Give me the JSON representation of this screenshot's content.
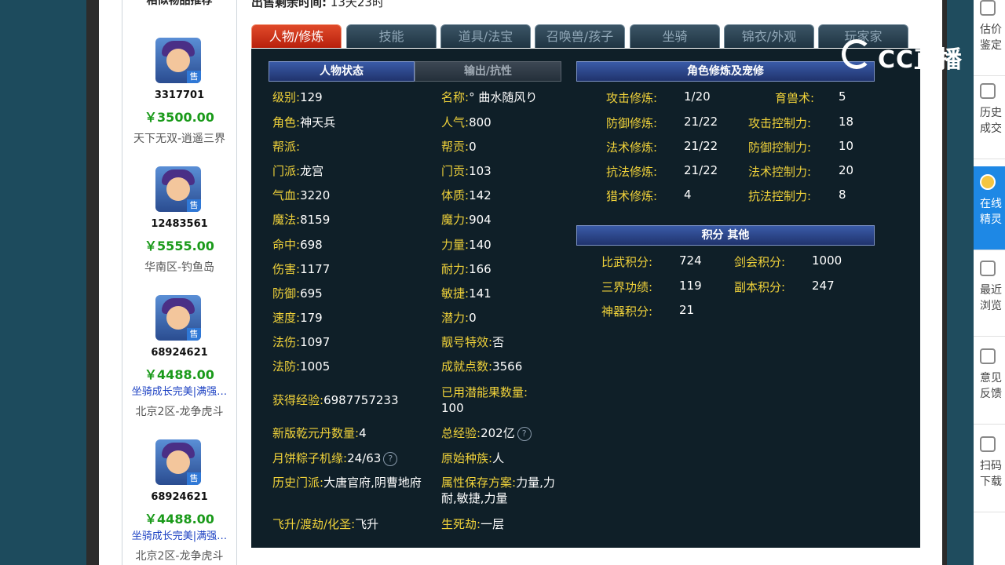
{
  "similar": {
    "title": "相似物品推荐",
    "items": [
      {
        "id": "3317701",
        "price": "￥3500.00",
        "desc": "",
        "server": "天下无双-逍遥三界",
        "tag": "售"
      },
      {
        "id": "12483561",
        "price": "￥5555.00",
        "desc": "",
        "server": "华南区-钓鱼岛",
        "tag": "售"
      },
      {
        "id": "68924621",
        "price": "￥4488.00",
        "desc": "坐骑成长完美|满强…",
        "server": "北京2区-龙争虎斗",
        "tag": "售"
      },
      {
        "id": "68924621",
        "price": "￥4488.00",
        "desc": "坐骑成长完美|满强…",
        "server": "北京2区-龙争虎斗",
        "tag": "售"
      }
    ]
  },
  "sale_time": {
    "label": "出售剩余时间:",
    "value": "13天23时"
  },
  "tabs": [
    "人物/修炼",
    "技能",
    "道具/法宝",
    "召唤兽/孩子",
    "坐骑",
    "锦衣/外观",
    "玩家家"
  ],
  "left_headers": {
    "active": "人物状态",
    "inactive": "输出/抗性"
  },
  "status": {
    "col1": [
      {
        "label": "级别:",
        "value": "129"
      },
      {
        "label": "角色:",
        "value": "神天兵"
      },
      {
        "label": "帮派:",
        "value": ""
      },
      {
        "label": "门派:",
        "value": "龙宫"
      },
      {
        "label": "气血:",
        "value": "3220"
      },
      {
        "label": "魔法:",
        "value": "8159"
      },
      {
        "label": "命中:",
        "value": "698"
      },
      {
        "label": "伤害:",
        "value": "1177"
      },
      {
        "label": "防御:",
        "value": "695"
      },
      {
        "label": "速度:",
        "value": "179"
      },
      {
        "label": "法伤:",
        "value": "1097"
      },
      {
        "label": "法防:",
        "value": "1005"
      }
    ],
    "col2": [
      {
        "label": "名称:",
        "value": "° 曲水随风り"
      },
      {
        "label": "人气:",
        "value": "800"
      },
      {
        "label": "帮贡:",
        "value": "0"
      },
      {
        "label": "门贡:",
        "value": "103"
      },
      {
        "label": "体质:",
        "value": "142"
      },
      {
        "label": "魔力:",
        "value": "904"
      },
      {
        "label": "力量:",
        "value": "140"
      },
      {
        "label": "耐力:",
        "value": "166"
      },
      {
        "label": "敏捷:",
        "value": "141"
      },
      {
        "label": "潜力:",
        "value": "0"
      },
      {
        "label": "靓号特效:",
        "value": "否"
      },
      {
        "label": "成就点数:",
        "value": "3566"
      }
    ],
    "exp": {
      "label": "获得经验:",
      "value": "6987757233"
    },
    "potential_fruit": {
      "label": "已用潜能果数量:",
      "value": "100"
    },
    "qianyuan": {
      "label": "新版乾元丹数量:",
      "value": "4"
    },
    "total_exp": {
      "label": "总经验:",
      "value": "202亿"
    },
    "yuebing": {
      "label": "月饼粽子机缘:",
      "value": "24/63"
    },
    "race": {
      "label": "原始种族:",
      "value": "人"
    },
    "history": {
      "label": "历史门派:",
      "value": "大唐官府,阴曹地府"
    },
    "attr_plan": {
      "label": "属性保存方案:",
      "value": "力量,力耐,敏捷,力量"
    },
    "feisheng": {
      "label": "飞升/渡劫/化圣:",
      "value": "飞升"
    },
    "shengsijie": {
      "label": "生死劫:",
      "value": "一层"
    },
    "help_glyph": "?"
  },
  "cultivation": {
    "title": "角色修炼及宠修",
    "rows": [
      {
        "l1": "攻击修炼:",
        "v1": "1/20",
        "l2": "育兽术:",
        "v2": "5"
      },
      {
        "l1": "防御修炼:",
        "v1": "21/22",
        "l2": "攻击控制力:",
        "v2": "18"
      },
      {
        "l1": "法术修炼:",
        "v1": "21/22",
        "l2": "防御控制力:",
        "v2": "10"
      },
      {
        "l1": "抗法修炼:",
        "v1": "21/22",
        "l2": "法术控制力:",
        "v2": "20"
      },
      {
        "l1": "猎术修炼:",
        "v1": "4",
        "l2": "抗法控制力:",
        "v2": "8"
      }
    ]
  },
  "points": {
    "title": "积分 其他",
    "rows": [
      {
        "l1": "比武积分:",
        "v1": "724",
        "l2": "剑会积分:",
        "v2": "1000"
      },
      {
        "l1": "三界功绩:",
        "v1": "119",
        "l2": "副本积分:",
        "v2": "247"
      },
      {
        "l1": "神器积分:",
        "v1": "21",
        "l2": "",
        "v2": ""
      }
    ]
  },
  "logo": {
    "text": "CC直播"
  },
  "right_panel": [
    {
      "label": "估价\n鉴定",
      "icon": "gear-icon"
    },
    {
      "label": "历史\n成交",
      "icon": "check-icon"
    },
    {
      "label": "在线\n精灵",
      "icon": "avatar-icon"
    },
    {
      "label": "最近\n浏览",
      "icon": "clock-icon"
    },
    {
      "label": "意见\n反馈",
      "icon": "edit-icon"
    },
    {
      "label": "扫码\n下载",
      "icon": "scan-icon"
    }
  ]
}
